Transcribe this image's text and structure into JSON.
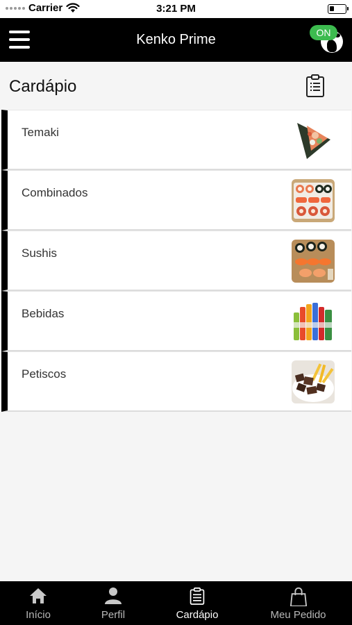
{
  "status_bar": {
    "carrier": "Carrier",
    "time": "3:21 PM",
    "icons": [
      "signal-dots-icon",
      "wifi-icon",
      "battery-icon"
    ]
  },
  "header": {
    "title": "Kenko Prime",
    "status_badge": "ON",
    "status_color": "#3dbb4f",
    "icons": [
      "menu-icon",
      "globe-icon"
    ]
  },
  "page": {
    "title": "Cardápio",
    "action_icon": "clipboard-icon"
  },
  "categories": [
    {
      "label": "Temaki",
      "icon": "temaki-thumbnail"
    },
    {
      "label": "Combinados",
      "icon": "combinados-thumbnail"
    },
    {
      "label": "Sushis",
      "icon": "sushis-thumbnail"
    },
    {
      "label": "Bebidas",
      "icon": "bebidas-thumbnail"
    },
    {
      "label": "Petiscos",
      "icon": "petiscos-thumbnail"
    }
  ],
  "tabs": [
    {
      "label": "Início",
      "icon": "home-icon",
      "active": false
    },
    {
      "label": "Perfil",
      "icon": "user-icon",
      "active": false
    },
    {
      "label": "Cardápio",
      "icon": "clipboard-icon",
      "active": true
    },
    {
      "label": "Meu Pedido",
      "icon": "bag-icon",
      "active": false
    }
  ],
  "colors": {
    "header_bg": "#000000",
    "background": "#f5f5f5",
    "accent_on": "#3dbb4f"
  }
}
